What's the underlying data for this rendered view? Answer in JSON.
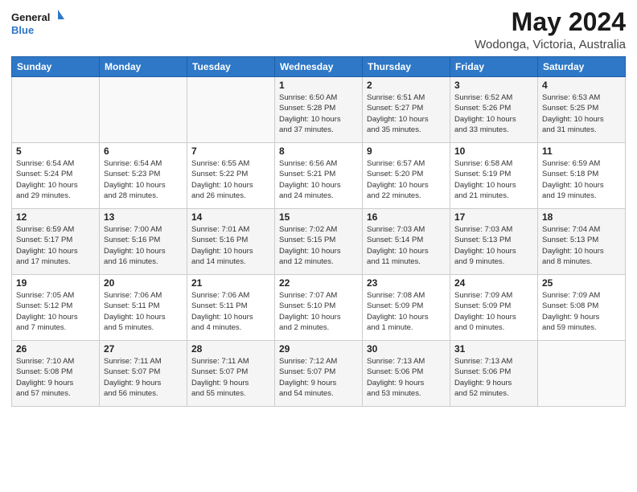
{
  "logo": {
    "line1": "General",
    "line2": "Blue"
  },
  "title": "May 2024",
  "location": "Wodonga, Victoria, Australia",
  "days_header": [
    "Sunday",
    "Monday",
    "Tuesday",
    "Wednesday",
    "Thursday",
    "Friday",
    "Saturday"
  ],
  "weeks": [
    [
      {
        "day": "",
        "info": ""
      },
      {
        "day": "",
        "info": ""
      },
      {
        "day": "",
        "info": ""
      },
      {
        "day": "1",
        "info": "Sunrise: 6:50 AM\nSunset: 5:28 PM\nDaylight: 10 hours\nand 37 minutes."
      },
      {
        "day": "2",
        "info": "Sunrise: 6:51 AM\nSunset: 5:27 PM\nDaylight: 10 hours\nand 35 minutes."
      },
      {
        "day": "3",
        "info": "Sunrise: 6:52 AM\nSunset: 5:26 PM\nDaylight: 10 hours\nand 33 minutes."
      },
      {
        "day": "4",
        "info": "Sunrise: 6:53 AM\nSunset: 5:25 PM\nDaylight: 10 hours\nand 31 minutes."
      }
    ],
    [
      {
        "day": "5",
        "info": "Sunrise: 6:54 AM\nSunset: 5:24 PM\nDaylight: 10 hours\nand 29 minutes."
      },
      {
        "day": "6",
        "info": "Sunrise: 6:54 AM\nSunset: 5:23 PM\nDaylight: 10 hours\nand 28 minutes."
      },
      {
        "day": "7",
        "info": "Sunrise: 6:55 AM\nSunset: 5:22 PM\nDaylight: 10 hours\nand 26 minutes."
      },
      {
        "day": "8",
        "info": "Sunrise: 6:56 AM\nSunset: 5:21 PM\nDaylight: 10 hours\nand 24 minutes."
      },
      {
        "day": "9",
        "info": "Sunrise: 6:57 AM\nSunset: 5:20 PM\nDaylight: 10 hours\nand 22 minutes."
      },
      {
        "day": "10",
        "info": "Sunrise: 6:58 AM\nSunset: 5:19 PM\nDaylight: 10 hours\nand 21 minutes."
      },
      {
        "day": "11",
        "info": "Sunrise: 6:59 AM\nSunset: 5:18 PM\nDaylight: 10 hours\nand 19 minutes."
      }
    ],
    [
      {
        "day": "12",
        "info": "Sunrise: 6:59 AM\nSunset: 5:17 PM\nDaylight: 10 hours\nand 17 minutes."
      },
      {
        "day": "13",
        "info": "Sunrise: 7:00 AM\nSunset: 5:16 PM\nDaylight: 10 hours\nand 16 minutes."
      },
      {
        "day": "14",
        "info": "Sunrise: 7:01 AM\nSunset: 5:16 PM\nDaylight: 10 hours\nand 14 minutes."
      },
      {
        "day": "15",
        "info": "Sunrise: 7:02 AM\nSunset: 5:15 PM\nDaylight: 10 hours\nand 12 minutes."
      },
      {
        "day": "16",
        "info": "Sunrise: 7:03 AM\nSunset: 5:14 PM\nDaylight: 10 hours\nand 11 minutes."
      },
      {
        "day": "17",
        "info": "Sunrise: 7:03 AM\nSunset: 5:13 PM\nDaylight: 10 hours\nand 9 minutes."
      },
      {
        "day": "18",
        "info": "Sunrise: 7:04 AM\nSunset: 5:13 PM\nDaylight: 10 hours\nand 8 minutes."
      }
    ],
    [
      {
        "day": "19",
        "info": "Sunrise: 7:05 AM\nSunset: 5:12 PM\nDaylight: 10 hours\nand 7 minutes."
      },
      {
        "day": "20",
        "info": "Sunrise: 7:06 AM\nSunset: 5:11 PM\nDaylight: 10 hours\nand 5 minutes."
      },
      {
        "day": "21",
        "info": "Sunrise: 7:06 AM\nSunset: 5:11 PM\nDaylight: 10 hours\nand 4 minutes."
      },
      {
        "day": "22",
        "info": "Sunrise: 7:07 AM\nSunset: 5:10 PM\nDaylight: 10 hours\nand 2 minutes."
      },
      {
        "day": "23",
        "info": "Sunrise: 7:08 AM\nSunset: 5:09 PM\nDaylight: 10 hours\nand 1 minute."
      },
      {
        "day": "24",
        "info": "Sunrise: 7:09 AM\nSunset: 5:09 PM\nDaylight: 10 hours\nand 0 minutes."
      },
      {
        "day": "25",
        "info": "Sunrise: 7:09 AM\nSunset: 5:08 PM\nDaylight: 9 hours\nand 59 minutes."
      }
    ],
    [
      {
        "day": "26",
        "info": "Sunrise: 7:10 AM\nSunset: 5:08 PM\nDaylight: 9 hours\nand 57 minutes."
      },
      {
        "day": "27",
        "info": "Sunrise: 7:11 AM\nSunset: 5:07 PM\nDaylight: 9 hours\nand 56 minutes."
      },
      {
        "day": "28",
        "info": "Sunrise: 7:11 AM\nSunset: 5:07 PM\nDaylight: 9 hours\nand 55 minutes."
      },
      {
        "day": "29",
        "info": "Sunrise: 7:12 AM\nSunset: 5:07 PM\nDaylight: 9 hours\nand 54 minutes."
      },
      {
        "day": "30",
        "info": "Sunrise: 7:13 AM\nSunset: 5:06 PM\nDaylight: 9 hours\nand 53 minutes."
      },
      {
        "day": "31",
        "info": "Sunrise: 7:13 AM\nSunset: 5:06 PM\nDaylight: 9 hours\nand 52 minutes."
      },
      {
        "day": "",
        "info": ""
      }
    ]
  ]
}
